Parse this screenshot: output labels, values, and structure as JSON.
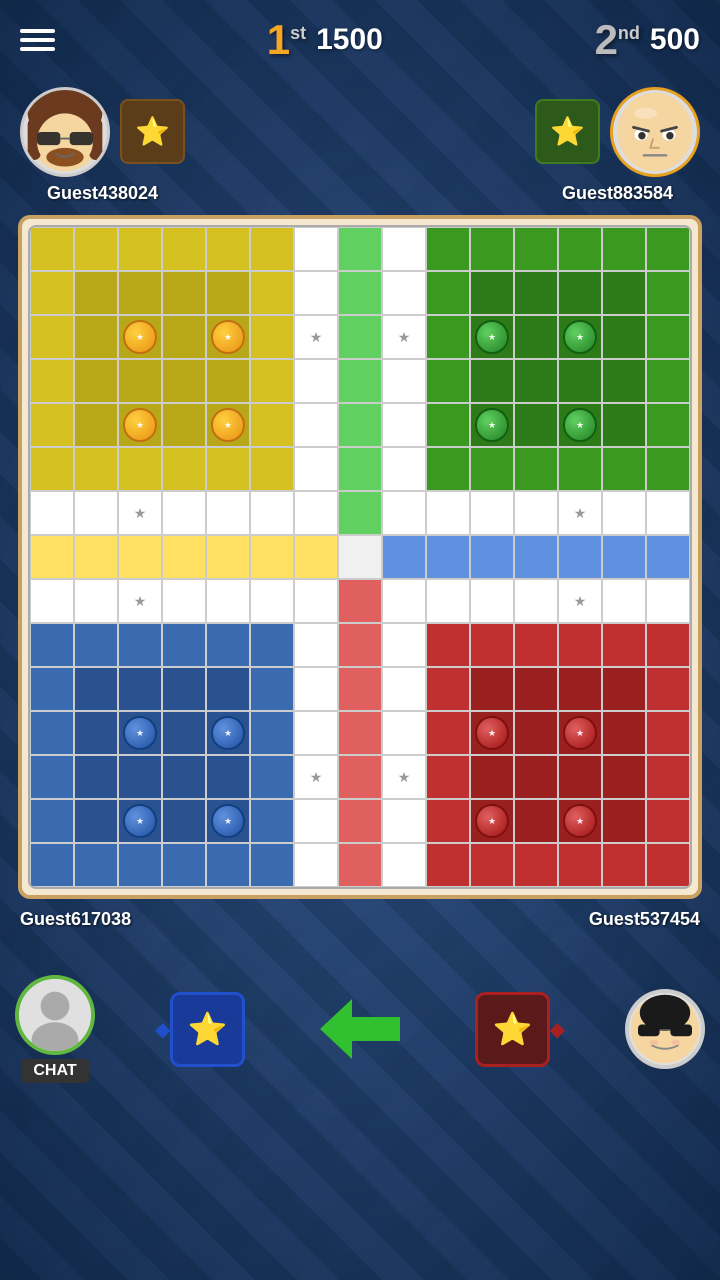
{
  "header": {
    "rank1": "1",
    "rank1_suffix": "st",
    "score1": "1500",
    "rank2": "2",
    "rank2_suffix": "nd",
    "score2": "500",
    "menu_label": "menu"
  },
  "players": {
    "top_left": {
      "name": "Guest438024",
      "avatar_type": "hair",
      "star_box_color": "brown"
    },
    "top_right": {
      "name": "Guest883584",
      "avatar_type": "bald",
      "star_box_color": "green"
    },
    "bottom_left": {
      "name": "Guest617038",
      "avatar_type": "silhouette",
      "star_box_color": "blue"
    },
    "bottom_right": {
      "name": "Guest537454",
      "avatar_type": "glasses",
      "star_box_color": "dark_red"
    }
  },
  "bottom_bar": {
    "chat_label": "CHAT",
    "arrow_direction": "left"
  },
  "board": {
    "colors": {
      "yellow": "#d4c020",
      "green": "#3a9a20",
      "blue": "#3a6ab0",
      "red": "#c03030"
    }
  }
}
